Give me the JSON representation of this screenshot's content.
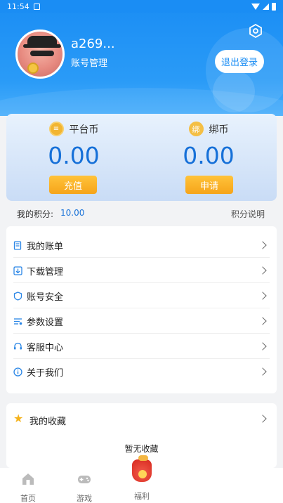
{
  "status_bar": {
    "time": "11:54"
  },
  "profile": {
    "username": "a269...",
    "account_management": "账号管理",
    "logout_label": "退出登录"
  },
  "wallet": {
    "platform": {
      "name": "平台币",
      "amount": "0.00",
      "button": "充值"
    },
    "bound": {
      "name": "绑币",
      "icon_text": "绑",
      "amount": "0.00",
      "button": "申请"
    }
  },
  "points": {
    "label": "我的积分:",
    "value": "10.00",
    "help": "积分说明"
  },
  "menu": {
    "items": [
      {
        "label": "我的账单",
        "icon": "bill-icon"
      },
      {
        "label": "下载管理",
        "icon": "download-icon"
      },
      {
        "label": "账号安全",
        "icon": "shield-icon"
      },
      {
        "label": "参数设置",
        "icon": "settings-list-icon"
      },
      {
        "label": "客服中心",
        "icon": "headset-icon"
      },
      {
        "label": "关于我们",
        "icon": "info-icon"
      }
    ]
  },
  "favorites": {
    "label": "我的收藏",
    "empty_text": "暂无收藏"
  },
  "tabs": [
    {
      "label": "首页",
      "icon": "home-icon"
    },
    {
      "label": "游戏",
      "icon": "gamepad-icon"
    },
    {
      "label": "福利",
      "icon": "welfare-bag-icon"
    }
  ],
  "colors": {
    "primary": "#1a8df4",
    "amount": "#1670d8",
    "button_orange": "#f6a41a",
    "points_value": "#1a73d8"
  }
}
